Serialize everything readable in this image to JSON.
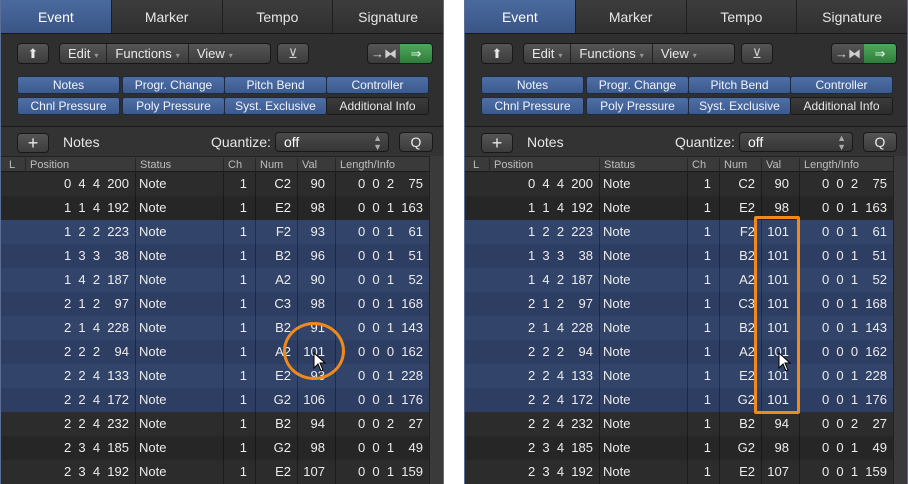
{
  "colors": {
    "accent": "#f08a1c",
    "selection": "#33446a",
    "tab_active": "#4a6a9e",
    "midi_on": "#3f9a4a"
  },
  "panels": [
    {
      "tabs": [
        "Event",
        "Marker",
        "Tempo",
        "Signature"
      ],
      "toolbar": {
        "up_icon": "⬆",
        "menus": [
          {
            "label": "Edit",
            "caret": "▾"
          },
          {
            "label": "Functions",
            "caret": "▾"
          },
          {
            "label": "View",
            "caret": "▾"
          }
        ],
        "filter_icon": "⊻",
        "midi_out_icon": "→⧓",
        "midi_in_icon": "⇒"
      },
      "filters_row1": [
        "Notes",
        "Progr. Change",
        "Pitch Bend",
        "Controller"
      ],
      "filters_row2": [
        "Chnl Pressure",
        "Poly Pressure",
        "Syst. Exclusive",
        "Additional Info"
      ],
      "list_header": {
        "plus": "+",
        "title": "Notes",
        "quantize_label": "Quantize:",
        "quantize_value": "off",
        "q_button": "Q"
      },
      "columns": [
        "L",
        "Position",
        "Status",
        "Ch",
        "Num",
        "Val",
        "Length/Info"
      ],
      "rows": [
        {
          "pos": "0  4  4  200",
          "status": "Note",
          "ch": "1",
          "num": "C2",
          "val": "90",
          "len": "0  0  2    75"
        },
        {
          "pos": "1  1  4  192",
          "status": "Note",
          "ch": "1",
          "num": "E2",
          "val": "98",
          "len": "0  0  1  163"
        },
        {
          "pos": "1  2  2  223",
          "status": "Note",
          "ch": "1",
          "num": "F2",
          "val": "93",
          "len": "0  0  1    61"
        },
        {
          "pos": "1  3  3    38",
          "status": "Note",
          "ch": "1",
          "num": "B2",
          "val": "96",
          "len": "0  0  1    51"
        },
        {
          "pos": "1  4  2  187",
          "status": "Note",
          "ch": "1",
          "num": "A2",
          "val": "90",
          "len": "0  0  1    52"
        },
        {
          "pos": "2  1  2    97",
          "status": "Note",
          "ch": "1",
          "num": "C3",
          "val": "98",
          "len": "0  0  1  168"
        },
        {
          "pos": "2  1  4  228",
          "status": "Note",
          "ch": "1",
          "num": "B2",
          "val": "91",
          "len": "0  0  1  143"
        },
        {
          "pos": "2  2  2    94",
          "status": "Note",
          "ch": "1",
          "num": "A2",
          "val": "101",
          "len": "0  0  0  162"
        },
        {
          "pos": "2  2  4  133",
          "status": "Note",
          "ch": "1",
          "num": "E2",
          "val": "93",
          "len": "0  0  1  228"
        },
        {
          "pos": "2  2  4  172",
          "status": "Note",
          "ch": "1",
          "num": "G2",
          "val": "106",
          "len": "0  0  1  176"
        },
        {
          "pos": "2  2  4  232",
          "status": "Note",
          "ch": "1",
          "num": "B2",
          "val": "94",
          "len": "0  0  2    27"
        },
        {
          "pos": "2  3  4  185",
          "status": "Note",
          "ch": "1",
          "num": "G2",
          "val": "98",
          "len": "0  0  1    49"
        },
        {
          "pos": "2  3  4  192",
          "status": "Note",
          "ch": "1",
          "num": "E2",
          "val": "107",
          "len": "0  0  1  159"
        }
      ]
    },
    {
      "tabs": [
        "Event",
        "Marker",
        "Tempo",
        "Signature"
      ],
      "toolbar": {
        "up_icon": "⬆",
        "menus": [
          {
            "label": "Edit",
            "caret": "▾"
          },
          {
            "label": "Functions",
            "caret": "▾"
          },
          {
            "label": "View",
            "caret": "▾"
          }
        ],
        "filter_icon": "⊻",
        "midi_out_icon": "→⧓",
        "midi_in_icon": "⇒"
      },
      "filters_row1": [
        "Notes",
        "Progr. Change",
        "Pitch Bend",
        "Controller"
      ],
      "filters_row2": [
        "Chnl Pressure",
        "Poly Pressure",
        "Syst. Exclusive",
        "Additional Info"
      ],
      "list_header": {
        "plus": "+",
        "title": "Notes",
        "quantize_label": "Quantize:",
        "quantize_value": "off",
        "q_button": "Q"
      },
      "columns": [
        "L",
        "Position",
        "Status",
        "Ch",
        "Num",
        "Val",
        "Length/Info"
      ],
      "rows": [
        {
          "pos": "0  4  4  200",
          "status": "Note",
          "ch": "1",
          "num": "C2",
          "val": "90",
          "len": "0  0  2    75"
        },
        {
          "pos": "1  1  4  192",
          "status": "Note",
          "ch": "1",
          "num": "E2",
          "val": "98",
          "len": "0  0  1  163"
        },
        {
          "pos": "1  2  2  223",
          "status": "Note",
          "ch": "1",
          "num": "F2",
          "val": "101",
          "len": "0  0  1    61"
        },
        {
          "pos": "1  3  3    38",
          "status": "Note",
          "ch": "1",
          "num": "B2",
          "val": "101",
          "len": "0  0  1    51"
        },
        {
          "pos": "1  4  2  187",
          "status": "Note",
          "ch": "1",
          "num": "A2",
          "val": "101",
          "len": "0  0  1    52"
        },
        {
          "pos": "2  1  2    97",
          "status": "Note",
          "ch": "1",
          "num": "C3",
          "val": "101",
          "len": "0  0  1  168"
        },
        {
          "pos": "2  1  4  228",
          "status": "Note",
          "ch": "1",
          "num": "B2",
          "val": "101",
          "len": "0  0  1  143"
        },
        {
          "pos": "2  2  2    94",
          "status": "Note",
          "ch": "1",
          "num": "A2",
          "val": "101",
          "len": "0  0  0  162"
        },
        {
          "pos": "2  2  4  133",
          "status": "Note",
          "ch": "1",
          "num": "E2",
          "val": "101",
          "len": "0  0  1  228"
        },
        {
          "pos": "2  2  4  172",
          "status": "Note",
          "ch": "1",
          "num": "G2",
          "val": "101",
          "len": "0  0  1  176"
        },
        {
          "pos": "2  2  4  232",
          "status": "Note",
          "ch": "1",
          "num": "B2",
          "val": "94",
          "len": "0  0  2    27"
        },
        {
          "pos": "2  3  4  185",
          "status": "Note",
          "ch": "1",
          "num": "G2",
          "val": "98",
          "len": "0  0  1    49"
        },
        {
          "pos": "2  3  4  192",
          "status": "Note",
          "ch": "1",
          "num": "E2",
          "val": "107",
          "len": "0  0  1  159"
        }
      ]
    }
  ]
}
